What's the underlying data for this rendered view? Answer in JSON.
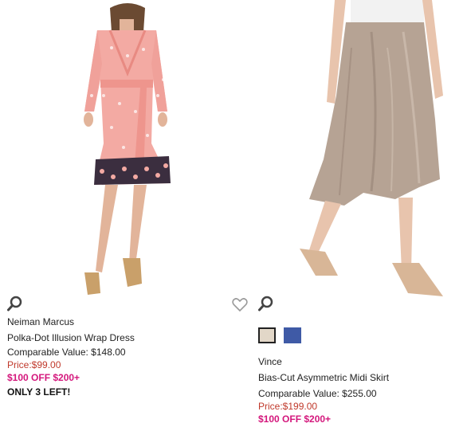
{
  "products": [
    {
      "brand": "Neiman Marcus",
      "name": "Polka-Dot Illusion Wrap Dress",
      "comparable": "Comparable Value: $148.00",
      "price": "Price:$99.00",
      "promo": "$100 OFF $200+",
      "stock": "ONLY 3 LEFT!"
    },
    {
      "brand": "Vince",
      "name": "Bias-Cut Asymmetric Midi Skirt",
      "comparable": "Comparable Value: $255.00",
      "price": "Price:$199.00",
      "promo": "$100 OFF $200+",
      "swatches": [
        {
          "color": "#e2d7c8",
          "selected": true
        },
        {
          "color": "#3f5aa6",
          "selected": false
        }
      ]
    }
  ],
  "icons": {
    "quickview": "magnifier-icon",
    "wishlist": "heart-outline-icon"
  },
  "colors": {
    "price": "#c0392b",
    "promo": "#d4177c",
    "dress": "#f2a7a1",
    "skirt": "#b7a596"
  }
}
